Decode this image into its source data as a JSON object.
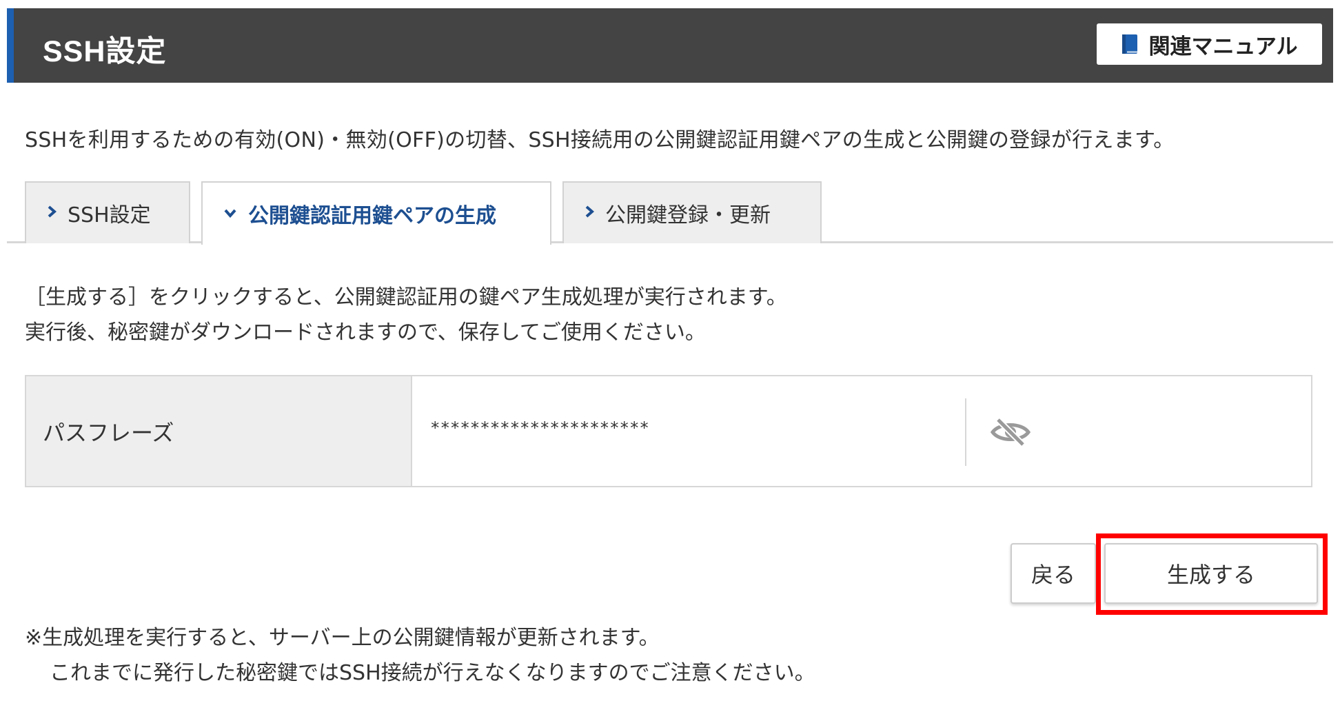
{
  "header": {
    "title": "SSH設定",
    "manual_button_label": "関連マニュアル",
    "manual_icon": "book-icon"
  },
  "description": "SSHを利用するための有効(ON)・無効(OFF)の切替、SSH接続用の公開鍵認証用鍵ペアの生成と公開鍵の登録が行えます。",
  "tabs": [
    {
      "label": "SSH設定",
      "active": false,
      "icon": "chevron-right-icon"
    },
    {
      "label": "公開鍵認証用鍵ペアの生成",
      "active": true,
      "icon": "chevron-down-icon"
    },
    {
      "label": "公開鍵登録・更新",
      "active": false,
      "icon": "chevron-right-icon"
    }
  ],
  "instructions": {
    "line1": "［生成する］をクリックすると、公開鍵認証用の鍵ペア生成処理が実行されます。",
    "line2": "実行後、秘密鍵がダウンロードされますので、保存してご使用ください。"
  },
  "form": {
    "passphrase_label": "パスフレーズ",
    "passphrase_value": "**********************",
    "visibility_icon": "eye-slash-icon"
  },
  "buttons": {
    "back_label": "戻る",
    "generate_label": "生成する"
  },
  "notes": {
    "line1": "※生成処理を実行すると、サーバー上の公開鍵情報が更新されます。",
    "line2": "これまでに発行した秘密鍵ではSSH接続が行えなくなりますのでご注意ください。"
  },
  "colors": {
    "header_bg": "#444444",
    "header_accent": "#1d5fb0",
    "active_tab_text": "#1d4f91",
    "highlight": "#ff0000"
  }
}
